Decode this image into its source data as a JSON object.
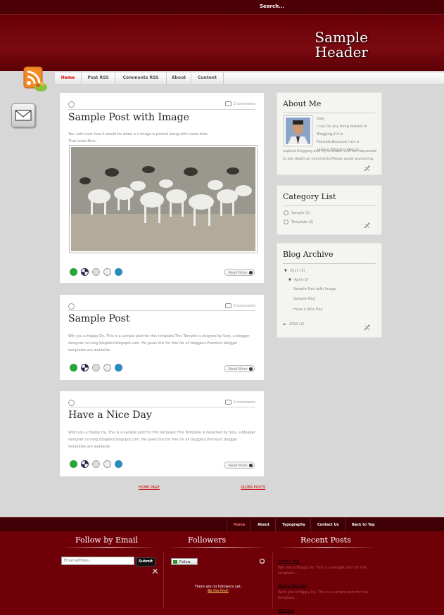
{
  "topbar": {
    "search_label": "Search..."
  },
  "header": {
    "title_line1": "Sample",
    "title_line2": "Header"
  },
  "nav": {
    "items": [
      "Home",
      "Post RSS",
      "Comments RSS",
      "About",
      "Content"
    ]
  },
  "posts": [
    {
      "title": "Sample Post with Image",
      "comments": "2 comments",
      "body_line1": "Yes, Lets Look how it would be when a n Image is posted along with some data.",
      "body_line2": "That looks Nice...",
      "read_more": "Read More"
    },
    {
      "title": "Sample Post",
      "comments": "0 comments",
      "body": "Wih you a Happy Dy, This is a sample post for this template.This Templte is deigned by Sooj, a blogger designer running blogkind.blogspot.com .He gives this for free for all bloggers.Premium blogger templates are available.",
      "read_more": "Read More"
    },
    {
      "title": "Have a Nice Day",
      "comments": "0 comments",
      "body": "Wish you a Happy Dy, This is a sample post for this template.This Template is designed by Sooj, a blogger designer running blogkind.blogspot.com .He gives this for free for all bloggers.Premium blogger templates are available.",
      "read_more": "Read More"
    }
  ],
  "pager": {
    "home": "HOME PAGE",
    "older": "OLDER POSTS"
  },
  "sidebar": {
    "about": {
      "title": "About Me",
      "name": "Sooj",
      "text_line1": "I can Do any thing related to",
      "text_line2": "Blogging,If it is",
      "text_line3": "Possible,Because I am a",
      "text_line4": "serious Blogger.I love to",
      "text_rest": "explore blogging and try to share it.All are requested to ask doubt on comments.Please avoid spamming."
    },
    "categories": {
      "title": "Category List",
      "items": [
        "Sample (1)",
        "Template (2)"
      ]
    },
    "archive": {
      "title": "Blog Archive",
      "year2011": "2011 (3)",
      "april": "April (3)",
      "posts": [
        "Sample Post with Image",
        "Sample Post",
        "Have a Nice Day"
      ],
      "year2010": "2010 (2)"
    }
  },
  "footer_nav": {
    "items": [
      "Home",
      "About",
      "Typography",
      "Contact Us",
      "Back to Top"
    ]
  },
  "footer": {
    "follow_email_title": "Follow by Email",
    "email_placeholder": "Email address...",
    "submit_label": "Submit",
    "followers_title": "Followers",
    "follow_label": "Follow",
    "followers_note1": "There are no followers yet.",
    "followers_note2": "Be the first!",
    "recent_title": "Recent Posts",
    "recent": [
      "Sample Post",
      "Have a Nice Day",
      "Welcome"
    ],
    "recent_snippet1": "Wih you a Happy Dy, This is a sample post for this template...",
    "recent_snippet2": "Wish you a Happy Dy, This is a sample post for this template..."
  },
  "colors": {
    "header_dark": "#5c0006",
    "accent": "#d40000",
    "footer_bg": "#700008"
  }
}
